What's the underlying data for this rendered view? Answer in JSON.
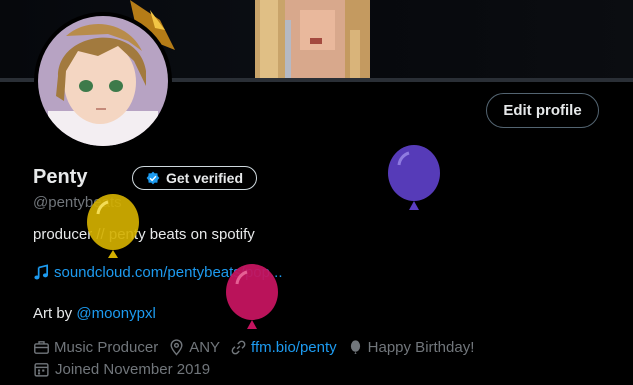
{
  "profile": {
    "name": "Penty",
    "handle": "@pentybeats",
    "bio": "producer // penty beats on spotify",
    "link_text": "soundcloud.com/pentybeats/pop...",
    "art_prefix": "Art by ",
    "art_mention": "@moonypxl",
    "category": "Music Producer",
    "location": "ANY",
    "website": "ffm.bio/penty",
    "birthday": "Happy Birthday!",
    "joined": "Joined November 2019"
  },
  "buttons": {
    "edit_profile": "Edit profile",
    "get_verified": "Get verified"
  },
  "colors": {
    "accent": "#1d9bf0",
    "balloon_yellow": "#d4b000",
    "balloon_purple": "#5b3ec2",
    "balloon_pink": "#c4145f"
  },
  "icons": [
    "music-note-icon",
    "briefcase-icon",
    "location-pin-icon",
    "link-icon",
    "balloon-icon",
    "calendar-icon",
    "verified-badge-icon"
  ]
}
